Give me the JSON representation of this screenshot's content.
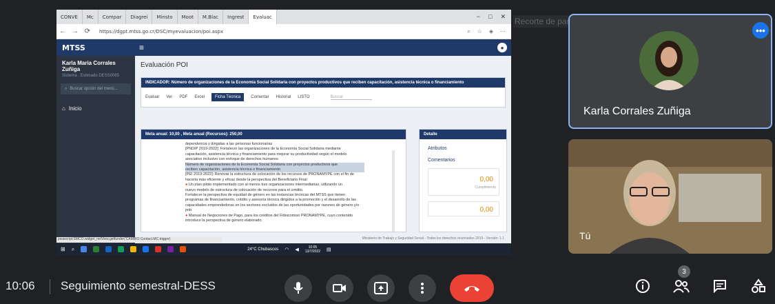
{
  "browser": {
    "tabs": [
      {
        "label": "CONVE"
      },
      {
        "label": "Mc"
      },
      {
        "label": "Compar"
      },
      {
        "label": "Diagrei"
      },
      {
        "label": "Minsto"
      },
      {
        "label": "Moot"
      },
      {
        "label": "M.Blac"
      },
      {
        "label": "Ingrest"
      },
      {
        "label": "Evaluac"
      }
    ],
    "url": "https://dgpt.mtss.go.cr/DSC/myevaluacion/poi.aspx",
    "status_url": "javascript:SMCO.widget_netView.getfunder('CAMBIO Contact.MC.trigger)"
  },
  "app": {
    "logo": "MTSS",
    "user_name": "Karla Maria Corrales Zuñiga",
    "user_sub": "Sistema . Estimado DESS0085",
    "search_placeholder": "Buscar opción del menú...",
    "nav_home": "Inicio",
    "page_title": "Evaluación POI",
    "indicator": "INDICADOR: Número de organizaciones de la Economía Social Solidaria con proyectos productivos que reciben capacitación, asistencia técnica o financiamiento",
    "toolbar": [
      "Evaluar",
      "Ver",
      "PDF",
      "Excel",
      "Ficha Técnica",
      "Comentar",
      "Historial",
      "LISTO"
    ],
    "toolbar_search": "Buscar",
    "meta_header": "Meta anual: 10,00 , Meta anual (Recursos): 250,00",
    "tree": [
      "dependencia y dirigidas a las personas funcionarias",
      "[PNDIP 2019-2022]: Fortalecer las organizaciones de la Economía Social Solidaria mediante",
      "capacitación, asistencia técnica y financiamiento para mejorar su productividad según el modelo",
      "asociativo inclusivo con enfoque de derechos humanos",
      "Número de organizaciones de la Economía Social Solidaria con proyectos productivos que",
      "reciben capacitación, asistencia técnica o financiamiento",
      "[PEI 2019-2022]: Renovar la estructura de colocación de los recursos de PRONAMYPE con el fin de",
      "hacerla más eficiente y eficaz desde la perspectiva del Beneficiario Final",
      "Un plan piloto implementado con al menos tres organizaciones intermediarias, utilizando un",
      "nuevo modelo de estructura de colocación de recursos para el crédito.",
      "Fortalecer la perspectiva de equidad de género en las instancias técnicas del MTSS que tienen",
      "programas de financiamiento, crédito y asesoría técnica dirigidos a la promoción y el desarrollo de las",
      "capacidades emprendedoras en los sectores excluidos de las oportunidades por razones de género y/o",
      "pob",
      "Manual de Negociones de Pago, para los créditos del Fideicomiso PRONAMYPE, cuyo contenido",
      "introduce la perspectiva de género elaborado."
    ],
    "detail_header": "Detalle",
    "detail_items": [
      "Atributos",
      "Comentarios"
    ],
    "detail_values": [
      {
        "value": "0,00",
        "caption": "Cumplimiento"
      },
      {
        "value": "0,00",
        "caption": ""
      }
    ],
    "footer_note": "Ministerio de Trabajo y Seguridad Social - Todos los derechos reservados 2019 - Versión: 1.1"
  },
  "taskbar": {
    "weather": "24°C Chubascos",
    "time": "10:05",
    "date": "13/7/2022"
  },
  "meet": {
    "caption_preview": "Recorte de pantalla completa",
    "participant_name": "Karla Corrales Zuñiga",
    "self_label": "Tú",
    "clock": "10:06",
    "meeting_title": "Seguimiento semestral-DESS",
    "participant_count": "3",
    "end_color": "#ea4335",
    "accent": "#1a73e8"
  }
}
